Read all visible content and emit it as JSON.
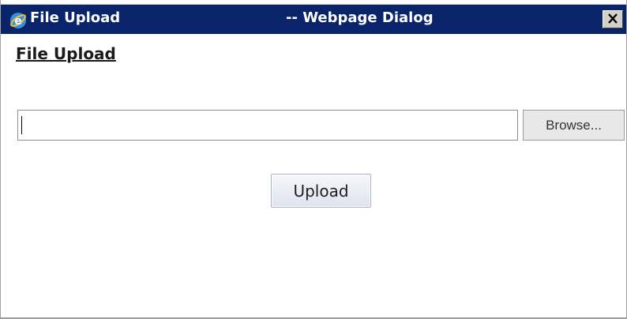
{
  "window": {
    "title": "File Upload",
    "title_suffix": "-- Webpage Dialog",
    "close_label": "X",
    "titlebar_color": "#0a246a",
    "icon": "internet-explorer-icon"
  },
  "content": {
    "heading": "File Upload",
    "file_input": {
      "value": "",
      "placeholder": ""
    },
    "browse_label": "Browse...",
    "upload_label": "Upload"
  }
}
